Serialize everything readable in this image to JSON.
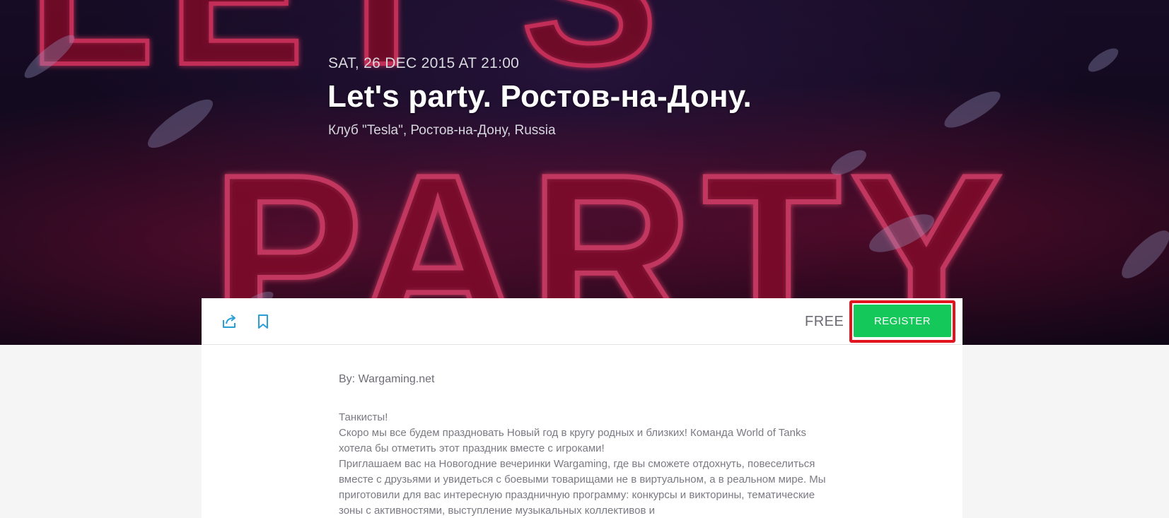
{
  "event": {
    "date": "SAT, 26 DEC 2015 AT 21:00",
    "title": "Let's party. Ростов-на-Дону.",
    "venue": "Клуб \"Tesla\", Ростов-на-Дону, Russia",
    "banner_text": "LET'S PARTY"
  },
  "actions": {
    "share_icon": "share-icon",
    "bookmark_icon": "bookmark-icon",
    "price": "FREE",
    "register_label": "REGISTER"
  },
  "details": {
    "organizer": "By: Wargaming.net",
    "paragraphs": [
      "Танкисты!",
      "Скоро мы все будем праздновать Новый год в кругу родных и близких! Команда World of Tanks хотела бы отметить этот праздник вместе с игроками!",
      "Приглашаем вас на Новогодние вечеринки Wargaming, где вы сможете отдохнуть, повеселиться вместе с друзьями и увидеться с боевыми товарищами не в виртуальном, а в реальном мире. Мы приготовили для вас интересную праздничную программу: конкурсы и викторины, тематические зоны с активностями, выступление музыкальных коллективов и"
    ]
  },
  "colors": {
    "register_bg": "#14c85a",
    "highlight": "#e2141e",
    "icon_accent": "#2a9fd6"
  }
}
